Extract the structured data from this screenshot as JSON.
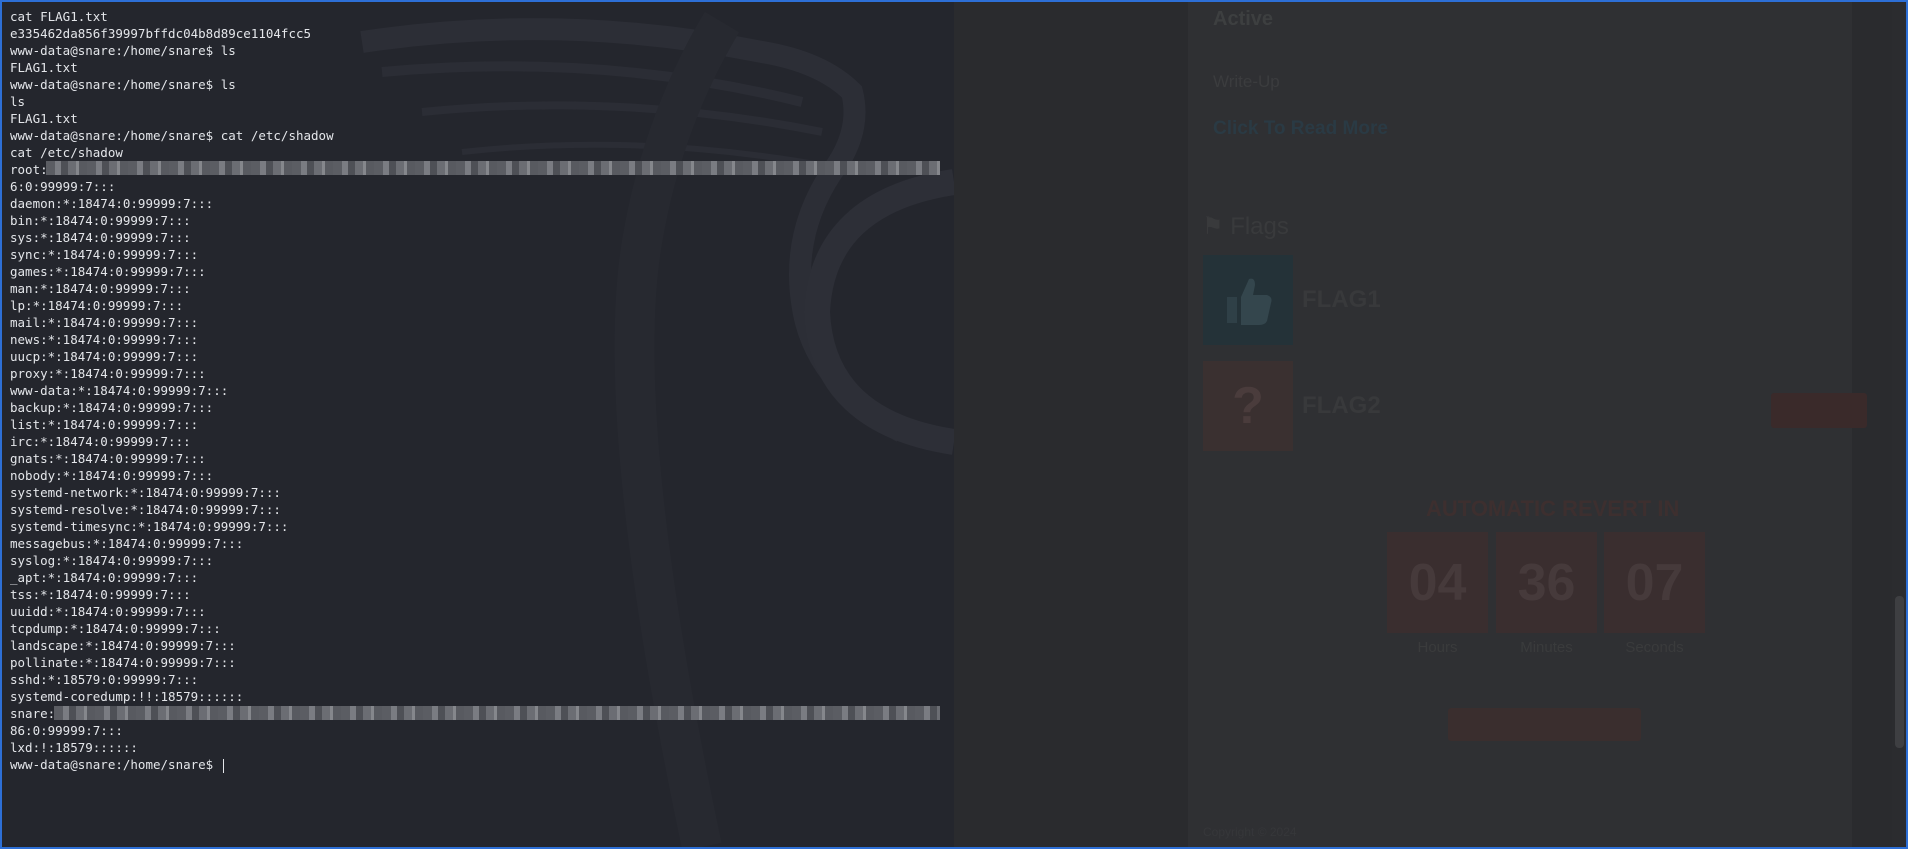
{
  "terminal": {
    "lines": [
      "cat FLAG1.txt",
      "e335462da856f39997bffdc04b8d89ce1104fcc5",
      "www-data@snare:/home/snare$ ls",
      "FLAG1.txt",
      "www-data@snare:/home/snare$ ls",
      "ls",
      "FLAG1.txt",
      "www-data@snare:/home/snare$ cat /etc/shadow",
      "cat /etc/shadow",
      "root:",
      "6:0:99999:7:::",
      "daemon:*:18474:0:99999:7:::",
      "bin:*:18474:0:99999:7:::",
      "sys:*:18474:0:99999:7:::",
      "sync:*:18474:0:99999:7:::",
      "games:*:18474:0:99999:7:::",
      "man:*:18474:0:99999:7:::",
      "lp:*:18474:0:99999:7:::",
      "mail:*:18474:0:99999:7:::",
      "news:*:18474:0:99999:7:::",
      "uucp:*:18474:0:99999:7:::",
      "proxy:*:18474:0:99999:7:::",
      "www-data:*:18474:0:99999:7:::",
      "backup:*:18474:0:99999:7:::",
      "list:*:18474:0:99999:7:::",
      "irc:*:18474:0:99999:7:::",
      "gnats:*:18474:0:99999:7:::",
      "nobody:*:18474:0:99999:7:::",
      "systemd-network:*:18474:0:99999:7:::",
      "systemd-resolve:*:18474:0:99999:7:::",
      "systemd-timesync:*:18474:0:99999:7:::",
      "messagebus:*:18474:0:99999:7:::",
      "syslog:*:18474:0:99999:7:::",
      "_apt:*:18474:0:99999:7:::",
      "tss:*:18474:0:99999:7:::",
      "uuidd:*:18474:0:99999:7:::",
      "tcpdump:*:18474:0:99999:7:::",
      "landscape:*:18474:0:99999:7:::",
      "pollinate:*:18474:0:99999:7:::",
      "sshd:*:18579:0:99999:7:::",
      "systemd-coredump:!!:18579::::::",
      "snare:",
      "86:0:99999:7:::",
      "lxd:!:18579::::::",
      "www-data@snare:/home/snare$ "
    ]
  },
  "site": {
    "status": "Active",
    "writeup": "Write-Up",
    "read_more": "Click To Read More",
    "flags_heading": "Flags",
    "flag1": "FLAG1",
    "flag2": "FLAG2",
    "flag1_icon": "thumbs-up-icon",
    "flag2_icon": "question-icon",
    "revert_title": "AUTOMATIC REVERT IN",
    "hours": "04",
    "minutes": "36",
    "seconds": "07",
    "hours_label": "Hours",
    "minutes_label": "Minutes",
    "seconds_label": "Seconds",
    "copyright": "Copyright © 2024"
  },
  "colors": {
    "window_border": "#2d6fd6",
    "terminal_bg": "#24262d",
    "terminal_text": "#e4e6ea"
  }
}
